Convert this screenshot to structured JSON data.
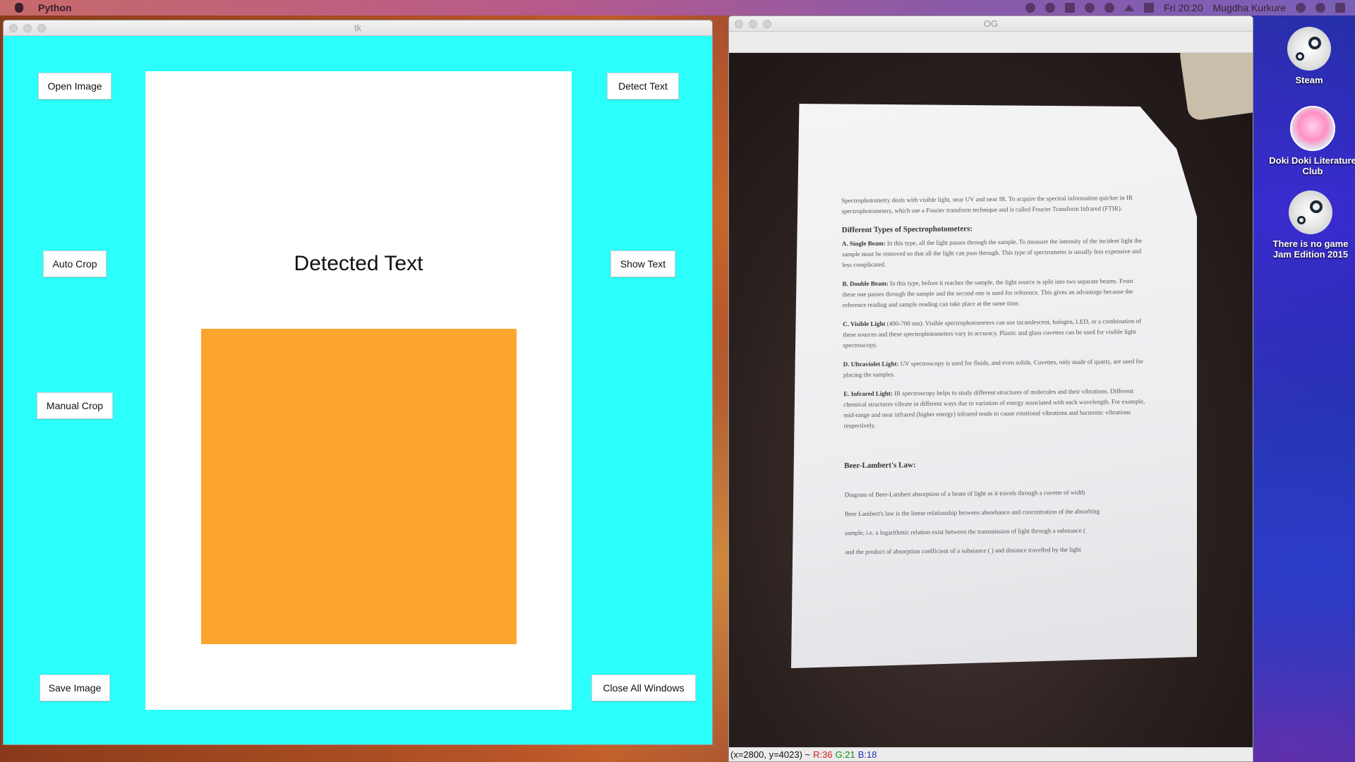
{
  "menubar": {
    "app_name": "Python",
    "clock": "Fri 20:20",
    "user": "Mugdha Kurkure"
  },
  "tk_window": {
    "title": "tk",
    "buttons": {
      "open_image": "Open Image",
      "detect_text": "Detect Text",
      "auto_crop": "Auto Crop",
      "show_text": "Show Text",
      "manual_crop": "Manual Crop",
      "save_image": "Save Image",
      "close_all": "Close All Windows"
    },
    "panel_title": "Detected Text",
    "colors": {
      "background": "#2bfffb",
      "image_placeholder": "#fba52e"
    }
  },
  "og_window": {
    "title": "OG",
    "status": {
      "coords": "(x=2800, y=4023) ~",
      "r": "R:36",
      "g": "G:21",
      "b": "B:18"
    },
    "document": {
      "intro": "Spectrophotometry deals with visible light, near UV and near IR. To acquire the spectral information quicker in IR spectrophotometers, which use a Fourier transform technique and is called Fourier Transform Infrared (FTIR).",
      "heading_types": "Different Types of Spectrophotometers:",
      "a_label": "A. Single Beam:",
      "a_text": "In this type, all the light passes through the sample. To measure the intensity of the incident light the sample must be removed so that all the light can pass through. This type of spectrometer is usually less expensive and less complicated.",
      "b_label": "B. Double Beam:",
      "b_text": "In this type, before it reaches the sample, the light source is split into two separate beams. From these one passes through the sample and the second one is used for reference. This gives an advantage because the reference reading and sample reading can take place at the same time.",
      "c_label": "C. Visible Light",
      "c_text": "(400-700 nm): Visible spectrophotometers can use incandescent, halogen, LED, or a combination of these sources and these spectrophotometers vary in accuracy. Plastic and glass cuvettes can be used for visible light spectroscopy.",
      "d_label": "D. Ultraviolet Light:",
      "d_text": "UV spectroscopy is used for fluids, and even solids. Cuvettes, only made of quartz, are used for placing the samples.",
      "e_label": "E. Infrared Light:",
      "e_text": "IR spectroscopy helps to study different structures of molecules and their vibrations. Different chemical structures vibrate in different ways due to variation of energy associated with each wavelength. For example, mid-range and near infrared (higher energy) infrared tends to cause rotational vibrations and harmonic vibrations respectively.",
      "heading_beer": "Beer-Lambert's Law:",
      "beer_1": "Diagram of Beer-Lambert absorption of a beam of light as it travels through a cuvette of width",
      "beer_2": "Beer Lambert's law is the linear relationship between absorbance and concentration of the absorbing",
      "beer_3": "sample, i.e. a logarithmic relation exist between the transmission of light through a substance (",
      "beer_4": "and the product of absorption coefficient of a substance (     ) and distance travelled by the light"
    }
  },
  "desktop": {
    "icons": [
      {
        "label": "Steam",
        "icon": "steam-icon"
      },
      {
        "label": "Doki Doki Literature Club",
        "icon": "ddlc-icon"
      },
      {
        "label": "There is no game Jam Edition 2015",
        "icon": "steam-icon"
      }
    ]
  }
}
